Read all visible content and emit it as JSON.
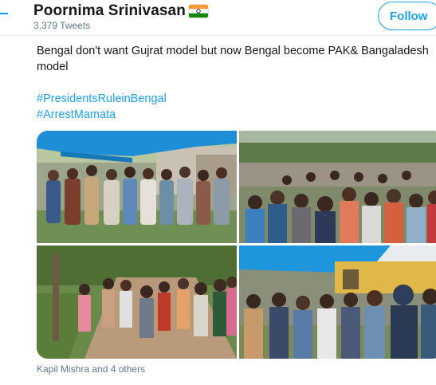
{
  "header": {
    "name": "Poornima Srinivasan",
    "tweets_count": "3,379 Tweets",
    "follow_label": "Follow"
  },
  "tweet": {
    "line1": "Bengal don't want Gujrat model but now Bengal become PAK& Bangaladesh",
    "line2": "model",
    "hashtag1": "#PresidentsRuleinBengal",
    "hashtag2": "#ArrestMamata"
  },
  "footer": {
    "tagged": "Kapil Mishra and 4 others"
  },
  "colors": {
    "accent": "#1da1f2",
    "text": "#14171a",
    "muted": "#657786"
  },
  "icons": [
    "back-arrow-icon",
    "india-flag-icon"
  ]
}
